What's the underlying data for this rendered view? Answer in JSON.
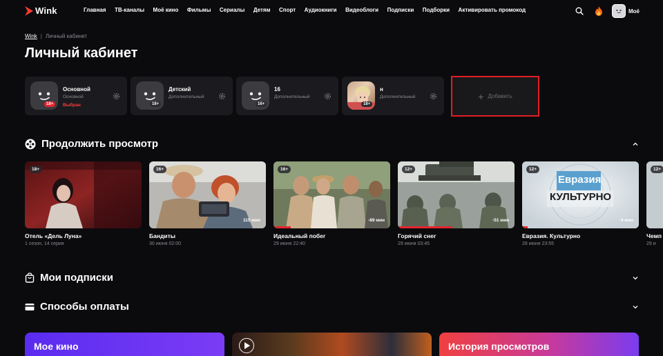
{
  "header": {
    "logo_text": "Wink",
    "nav": [
      "Главная",
      "ТВ-каналы",
      "Моё кино",
      "Фильмы",
      "Сериалы",
      "Детям",
      "Спорт",
      "Аудиокниги",
      "Видеоблоги",
      "Подписки",
      "Подборки",
      "Активировать промокод"
    ],
    "user_label": "Моё"
  },
  "breadcrumb": {
    "link": "Wink",
    "current": "Личный кабинет"
  },
  "page_title": "Личный кабинет",
  "profiles": [
    {
      "name": "Основной",
      "type": "Основной",
      "status": "Выбран",
      "age": "18+",
      "age_red": true
    },
    {
      "name": "Детский",
      "type": "Дополнительный",
      "status": "",
      "age": "18+"
    },
    {
      "name": "16",
      "type": "Дополнительный",
      "status": "",
      "age": "16+"
    },
    {
      "name": "н",
      "type": "Дополнительный",
      "status": "",
      "age": "18+"
    }
  ],
  "add_profile": {
    "label": "Добавить"
  },
  "sections": {
    "continue": "Продолжить просмотр",
    "subscriptions": "Мои подписки",
    "payment": "Способы оплаты"
  },
  "continue_items": [
    {
      "title": "Отель «Дель Луна»",
      "sub": "1 сезон, 14 серия",
      "age": "18+",
      "remain": "",
      "progress": 0
    },
    {
      "title": "Бандиты",
      "sub": "30 июня 02:00",
      "age": "16+",
      "remain": "115 мин",
      "progress": 0
    },
    {
      "title": "Идеальный побег",
      "sub": "29 июня 22:40",
      "age": "16+",
      "remain": "-89 мин",
      "progress": 0.15
    },
    {
      "title": "Горячий снег",
      "sub": "29 июня 03:45",
      "age": "12+",
      "remain": "-51 мин",
      "progress": 0.47
    },
    {
      "title": "Евразия. Культурно",
      "sub": "28 июня 23:55",
      "age": "12+",
      "remain": "-4 мин",
      "progress": 0.05,
      "poster_text": [
        "Евразия",
        "КУЛЬТУРНО"
      ]
    },
    {
      "title": "Чемп",
      "sub": "29 и",
      "age": "12+",
      "remain": "",
      "progress": 0
    }
  ],
  "promos": {
    "my_movies": "Мое кино",
    "history": "История просмотров"
  },
  "colors": {
    "accent": "#e5252e",
    "bg": "#0b0b0e",
    "card": "#1b1b1f"
  }
}
